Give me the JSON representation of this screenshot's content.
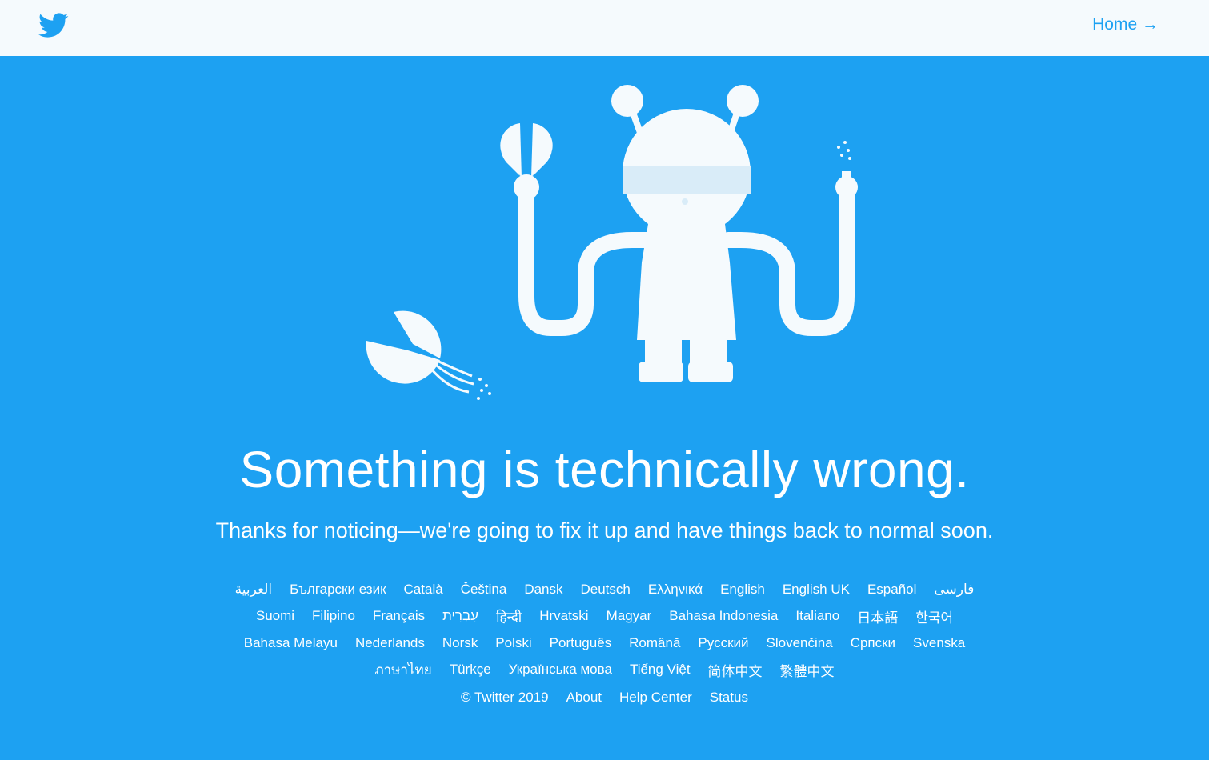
{
  "header": {
    "logo_icon": "twitter-bird-icon",
    "home_label": "Home →"
  },
  "error": {
    "title": "Something is technically wrong.",
    "message": "Thanks for noticing—we're going to fix it up and have things back to normal soon."
  },
  "languages": [
    [
      "العربية",
      "Български език",
      "Català",
      "Čeština",
      "Dansk",
      "Deutsch",
      "Ελληνικά",
      "English",
      "English UK",
      "Español",
      "فارسی"
    ],
    [
      "Suomi",
      "Filipino",
      "Français",
      "עִבְרִית",
      "हिन्दी",
      "Hrvatski",
      "Magyar",
      "Bahasa Indonesia",
      "Italiano",
      "日本語",
      "한국어"
    ],
    [
      "Bahasa Melayu",
      "Nederlands",
      "Norsk",
      "Polski",
      "Português",
      "Română",
      "Русский",
      "Slovenčina",
      "Српски",
      "Svenska"
    ],
    [
      "ภาษาไทย",
      "Türkçe",
      "Українська мова",
      "Tiếng Việt",
      "简体中文",
      "繁體中文"
    ]
  ],
  "footer": {
    "copyright": "© Twitter 2019",
    "about": "About",
    "help_center": "Help Center",
    "status": "Status"
  },
  "colors": {
    "background": "#1da1f2",
    "topbar": "#f5fafd",
    "accent": "#1da1f2",
    "text": "#ffffff"
  }
}
